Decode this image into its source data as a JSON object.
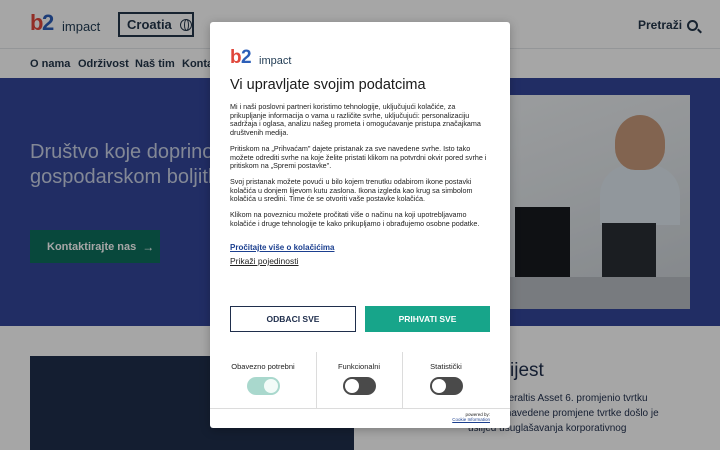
{
  "header": {
    "logo_word": "impact",
    "language": "Croatia",
    "search_label": "Pretraži"
  },
  "nav": {
    "items": [
      "O nama",
      "Održivost",
      "Naš tim",
      "Konta"
    ]
  },
  "hero": {
    "title": "Društvo koje doprinosi općem gospodarskom boljitku",
    "cta": "Kontaktirajte nas",
    "cta_arrow": "→"
  },
  "lower": {
    "heading": "ijest",
    "text": "kako je Veraltis Asset 6. promjenio tvrtku .o.o. Do navedene promjene tvrtke došlo je uslijed usuglašavanja korporativnog"
  },
  "cookie_dialog": {
    "logo_word": "impact",
    "title": "Vi upravljate svojim podatcima",
    "paragraphs": [
      "Mi i naši poslovni partneri koristimo tehnologije, uključujući kolačiće, za prikupljanje informacija o vama u različite svrhe, uključujući: personalizaciju sadržaja i oglasa, analizu našeg prometa i omogućavanje pristupa značajkama društvenih medija.",
      "Pritiskom na „Prihvaćam\" dajete pristanak za sve navedene svrhe. Isto tako možete odrediti svrhe na koje želite pristati klikom na potvrdni okvir pored svrhe i pritiskom na „Spremi postavke\".",
      "Svoj pristanak možete povući u bilo kojem trenutku odabirom ikone postavki kolačića u donjem lijevom kutu zaslona. Ikona izgleda kao krug sa simbolom kolačića u sredini. Time će se otvoriti vaše postavke kolačića.",
      "Klikom na poveznicu možete pročitati više o načinu na koji upotrebljavamo kolačiće i druge tehnologije te kako prikupljamo i obrađujemo osobne podatke."
    ],
    "read_more_link": "Pročitajte više o kolačićima",
    "show_details": "Prikaži pojedinosti",
    "reject_label": "ODBACI SVE",
    "accept_label": "PRIHVATI SVE",
    "toggles": [
      {
        "label": "Obavezno potrebni",
        "state": "on"
      },
      {
        "label": "Funkcionalni",
        "state": "off"
      },
      {
        "label": "Statistički",
        "state": "off"
      }
    ],
    "powered_by": "powered by:",
    "powered_by_name": "Cookie Information"
  },
  "colors": {
    "hero_bg": "#33469a",
    "accent_green": "#17a58a",
    "cta_green": "#0d6f5d",
    "navy": "#1f2e4c"
  }
}
